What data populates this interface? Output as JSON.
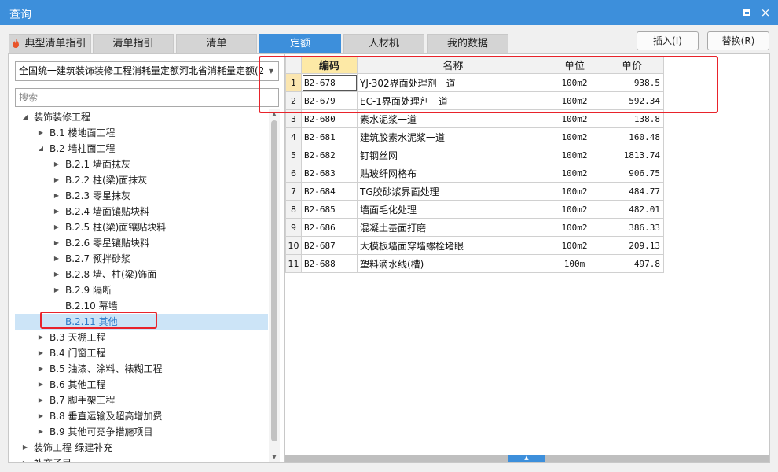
{
  "window": {
    "title": "查询",
    "maximize_icon": "maximize-icon",
    "close_label": "×"
  },
  "tabs": [
    {
      "label": "典型清单指引",
      "icon": "flame-icon"
    },
    {
      "label": "清单指引"
    },
    {
      "label": "清单"
    },
    {
      "label": "定额",
      "active": true
    },
    {
      "label": "人材机"
    },
    {
      "label": "我的数据"
    }
  ],
  "actions": {
    "insert_label": "插入(I)",
    "replace_label": "替换(R)"
  },
  "left": {
    "quota_library": "全国统一建筑装饰装修工程消耗量定额河北省消耗量定额(20",
    "search_placeholder": "搜索",
    "tree": [
      {
        "label": "装饰装修工程",
        "level": 0,
        "expanded": true
      },
      {
        "label": "B.1 楼地面工程",
        "level": 1,
        "expanded": false
      },
      {
        "label": "B.2 墙柱面工程",
        "level": 1,
        "expanded": true
      },
      {
        "label": "B.2.1 墙面抹灰",
        "level": 2,
        "expanded": false
      },
      {
        "label": "B.2.2 柱(梁)面抹灰",
        "level": 2,
        "expanded": false
      },
      {
        "label": "B.2.3 零星抹灰",
        "level": 2,
        "expanded": false
      },
      {
        "label": "B.2.4 墙面镶贴块料",
        "level": 2,
        "expanded": false
      },
      {
        "label": "B.2.5 柱(梁)面镶贴块料",
        "level": 2,
        "expanded": false
      },
      {
        "label": "B.2.6 零星镶贴块料",
        "level": 2,
        "expanded": false
      },
      {
        "label": "B.2.7 预拌砂浆",
        "level": 2,
        "expanded": false
      },
      {
        "label": "B.2.8 墙、柱(梁)饰面",
        "level": 2,
        "expanded": false
      },
      {
        "label": "B.2.9 隔断",
        "level": 2,
        "expanded": false
      },
      {
        "label": "B.2.10 幕墙",
        "level": 2,
        "leaf": true
      },
      {
        "label": "B.2.11 其他",
        "level": 2,
        "leaf": true,
        "selected": true
      },
      {
        "label": "B.3 天棚工程",
        "level": 1,
        "expanded": false
      },
      {
        "label": "B.4 门窗工程",
        "level": 1,
        "expanded": false
      },
      {
        "label": "B.5 油漆、涂料、裱糊工程",
        "level": 1,
        "expanded": false
      },
      {
        "label": "B.6 其他工程",
        "level": 1,
        "expanded": false
      },
      {
        "label": "B.7 脚手架工程",
        "level": 1,
        "expanded": false
      },
      {
        "label": "B.8 垂直运输及超高增加费",
        "level": 1,
        "expanded": false
      },
      {
        "label": "B.9 其他可竞争措施项目",
        "level": 1,
        "expanded": false
      },
      {
        "label": "装饰工程-绿建补充",
        "level": 0,
        "expanded": false
      },
      {
        "label": "补充子目",
        "level": 0,
        "expanded": false
      }
    ]
  },
  "grid": {
    "columns": {
      "code": "编码",
      "name": "名称",
      "unit": "单位",
      "price": "单价"
    },
    "rows": [
      {
        "n": "1",
        "code": "B2-678",
        "name": "YJ-302界面处理剂一道",
        "unit": "100m2",
        "price": "938.5"
      },
      {
        "n": "2",
        "code": "B2-679",
        "name": "EC-1界面处理剂一道",
        "unit": "100m2",
        "price": "592.34"
      },
      {
        "n": "3",
        "code": "B2-680",
        "name": "素水泥浆一道",
        "unit": "100m2",
        "price": "138.8"
      },
      {
        "n": "4",
        "code": "B2-681",
        "name": "建筑胶素水泥浆一道",
        "unit": "100m2",
        "price": "160.48"
      },
      {
        "n": "5",
        "code": "B2-682",
        "name": "钉钢丝网",
        "unit": "100m2",
        "price": "1813.74"
      },
      {
        "n": "6",
        "code": "B2-683",
        "name": "贴玻纤网格布",
        "unit": "100m2",
        "price": "906.75"
      },
      {
        "n": "7",
        "code": "B2-684",
        "name": "TG胶砂浆界面处理",
        "unit": "100m2",
        "price": "484.77"
      },
      {
        "n": "8",
        "code": "B2-685",
        "name": "墙面毛化处理",
        "unit": "100m2",
        "price": "482.01"
      },
      {
        "n": "9",
        "code": "B2-686",
        "name": "混凝土基面打磨",
        "unit": "100m2",
        "price": "386.33"
      },
      {
        "n": "10",
        "code": "B2-687",
        "name": "大模板墙面穿墙螺栓堵眼",
        "unit": "100m2",
        "price": "209.13"
      },
      {
        "n": "11",
        "code": "B2-688",
        "name": "塑料滴水线(槽)",
        "unit": "100m",
        "price": "497.8"
      }
    ]
  },
  "colors": {
    "accent": "#3d8fdb",
    "highlight": "#e8232b",
    "selected_row": "#cce4f7"
  }
}
